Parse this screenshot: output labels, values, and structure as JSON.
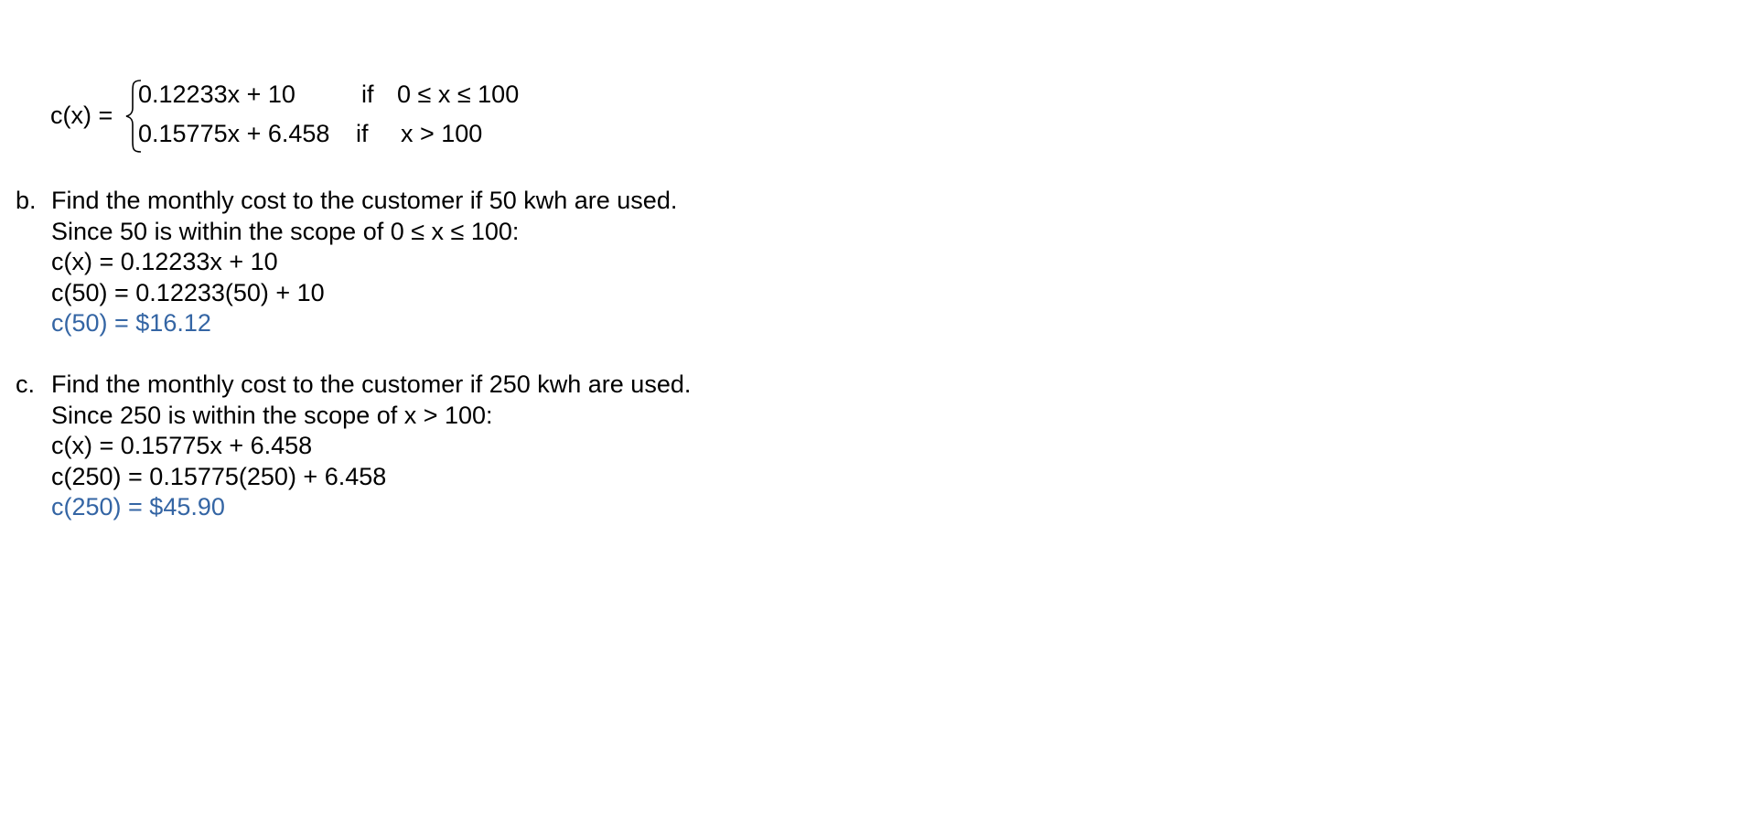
{
  "piecewise": {
    "lhs": "c(x) =",
    "rows": [
      {
        "expr": "0.12233x + 10",
        "if": "if",
        "cond": "0 ≤ x ≤ 100"
      },
      {
        "expr": "0.15775x + 6.458",
        "if": "if",
        "cond": "x > 100"
      }
    ]
  },
  "part_b": {
    "marker": "b.",
    "question": "Find the monthly cost to the customer if 50 kwh are used.",
    "scope": "Since 50 is within the scope of  0 ≤ x ≤ 100:",
    "formula": "c(x) = 0.12233x + 10",
    "substitution": "c(50) = 0.12233(50) + 10",
    "answer": "c(50) = $16.12"
  },
  "part_c": {
    "marker": "c.",
    "question": "Find the monthly cost to the customer if 250 kwh are used.",
    "scope": "Since 250 is within the scope of x > 100:",
    "formula": "c(x) = 0.15775x + 6.458",
    "substitution": "c(250) = 0.15775(250) + 6.458",
    "answer": "c(250) = $45.90"
  },
  "colors": {
    "text": "#000000",
    "answer": "#3465a4"
  }
}
